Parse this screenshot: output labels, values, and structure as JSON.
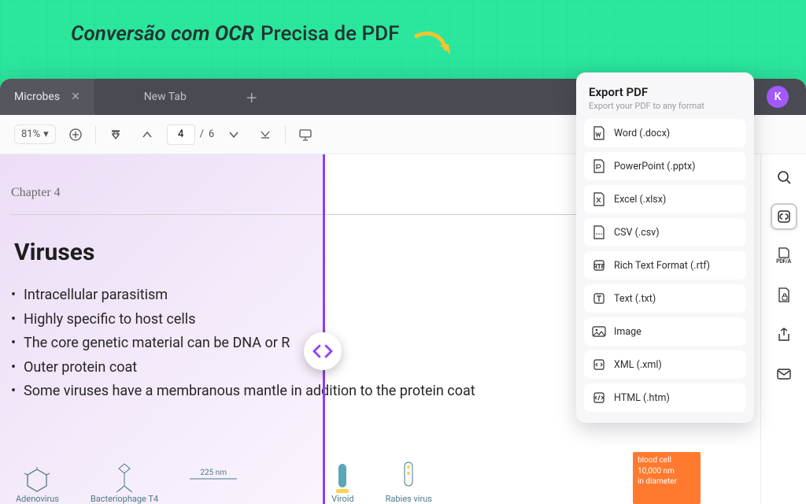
{
  "promo": {
    "cursive": "Conversão com ",
    "ocr": "OCR",
    "sans": "Precisa de PDF"
  },
  "tabs": {
    "active": "Microbes",
    "new": "New Tab"
  },
  "avatar": "K",
  "toolbar": {
    "zoom": "81%",
    "page_current": "4",
    "page_sep": "/",
    "page_total": "6"
  },
  "document": {
    "chapter": "Chapter 4",
    "heading": "Viruses",
    "bullets": [
      "Intracellular parasitism",
      "Highly specific to host cells",
      "The core genetic material can be DNA or R",
      "Outer protein coat",
      "Some viruses have a membranous mantle in addition to the protein coat"
    ],
    "doodles": {
      "adeno": "Adenovirus",
      "bactlen": "225 nm",
      "bact": "Bacteriophage T4",
      "viroid": "Viroid",
      "rabies": "Rabies virus"
    },
    "postit": {
      "l1": "blood cell",
      "l2": "10,000 nm",
      "l3": "in diameter"
    }
  },
  "export": {
    "title": "Export PDF",
    "subtitle": "Export your PDF to any format",
    "items": [
      "Word (.docx)",
      "PowerPoint (.pptx)",
      "Excel (.xlsx)",
      "CSV (.csv)",
      "Rich Text Format (.rtf)",
      "Text (.txt)",
      "Image",
      "XML (.xml)",
      "HTML (.htm)"
    ]
  }
}
